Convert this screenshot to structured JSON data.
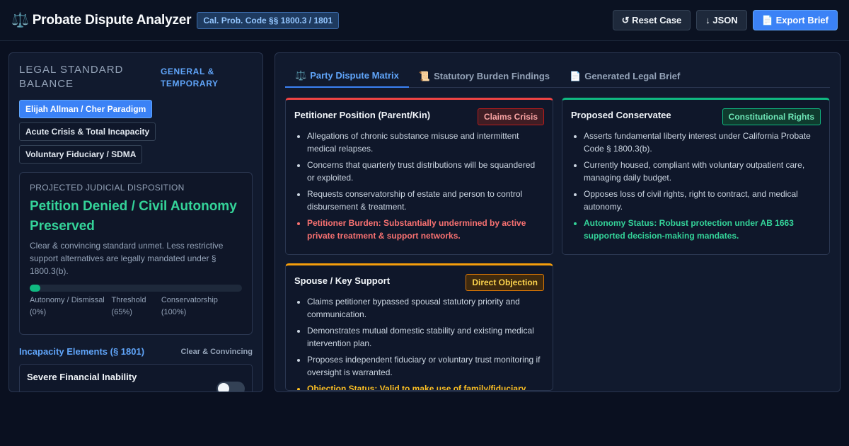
{
  "header": {
    "title": "Probate Dispute Analyzer",
    "code_badge": "Cal. Prob. Code §§ 1800.3 / 1801",
    "actions": {
      "reset": "↺ Reset Case",
      "json": "↓ JSON",
      "export": "📄 Export Brief"
    }
  },
  "left": {
    "title": "LEGAL STANDARD BALANCE",
    "tag": "GENERAL & TEMPORARY",
    "paradigms": [
      {
        "label": "Elijah Allman / Cher Paradigm",
        "active": true
      },
      {
        "label": "Acute Crisis & Total Incapacity",
        "active": false
      },
      {
        "label": "Voluntary Fiduciary / SDMA",
        "active": false
      }
    ],
    "disposition": {
      "label": "PROJECTED JUDICIAL DISPOSITION",
      "result": "Petition Denied / Civil Autonomy Preserved",
      "description": "Clear & convincing standard unmet. Less restrictive support alternatives are legally mandated under § 1800.3(b).",
      "bar_value_pct": 5,
      "scale": {
        "low": "Autonomy / Dismissal (0%)",
        "mid": "Threshold (65%)",
        "high": "Conservatorship (100%)"
      }
    },
    "elements": {
      "title": "Incapacity Elements (§ 1801)",
      "standard": "Clear & Convincing",
      "items": [
        {
          "name": "Severe Financial Inability",
          "enabled": false
        }
      ]
    }
  },
  "right": {
    "tabs": [
      {
        "icon": "⚖️",
        "label": "Party Dispute Matrix",
        "active": true
      },
      {
        "icon": "📜",
        "label": "Statutory Burden Findings",
        "active": false
      },
      {
        "icon": "📄",
        "label": "Generated Legal Brief",
        "active": false
      }
    ],
    "cards": [
      {
        "title": "Petitioner Position (Parent/Kin)",
        "badge": "Claims Crisis",
        "tone": "red",
        "points": [
          "Allegations of chronic substance misuse and intermittent medical relapses.",
          "Concerns that quarterly trust distributions will be squandered or exploited.",
          "Requests conservatorship of estate and person to control disbursement & treatment."
        ],
        "status": "Petitioner Burden: Substantially undermined by active private treatment & support networks."
      },
      {
        "title": "Proposed Conservatee",
        "badge": "Constitutional Rights",
        "tone": "green",
        "points": [
          "Asserts fundamental liberty interest under California Probate Code § 1800.3(b).",
          "Currently housed, compliant with voluntary outpatient care, managing daily budget.",
          "Opposes loss of civil rights, right to contract, and medical autonomy."
        ],
        "status": "Autonomy Status: Robust protection under AB 1663 supported decision-making mandates."
      },
      {
        "title": "Spouse / Key Support",
        "badge": "Direct Objection",
        "tone": "amber",
        "points": [
          "Claims petitioner bypassed spousal statutory priority and communication.",
          "Demonstrates mutual domestic stability and existing medical intervention plan.",
          "Proposes independent fiduciary or voluntary trust monitoring if oversight is warranted."
        ],
        "status": "Objection Status: Valid to make use of family/fiduciary"
      }
    ]
  }
}
